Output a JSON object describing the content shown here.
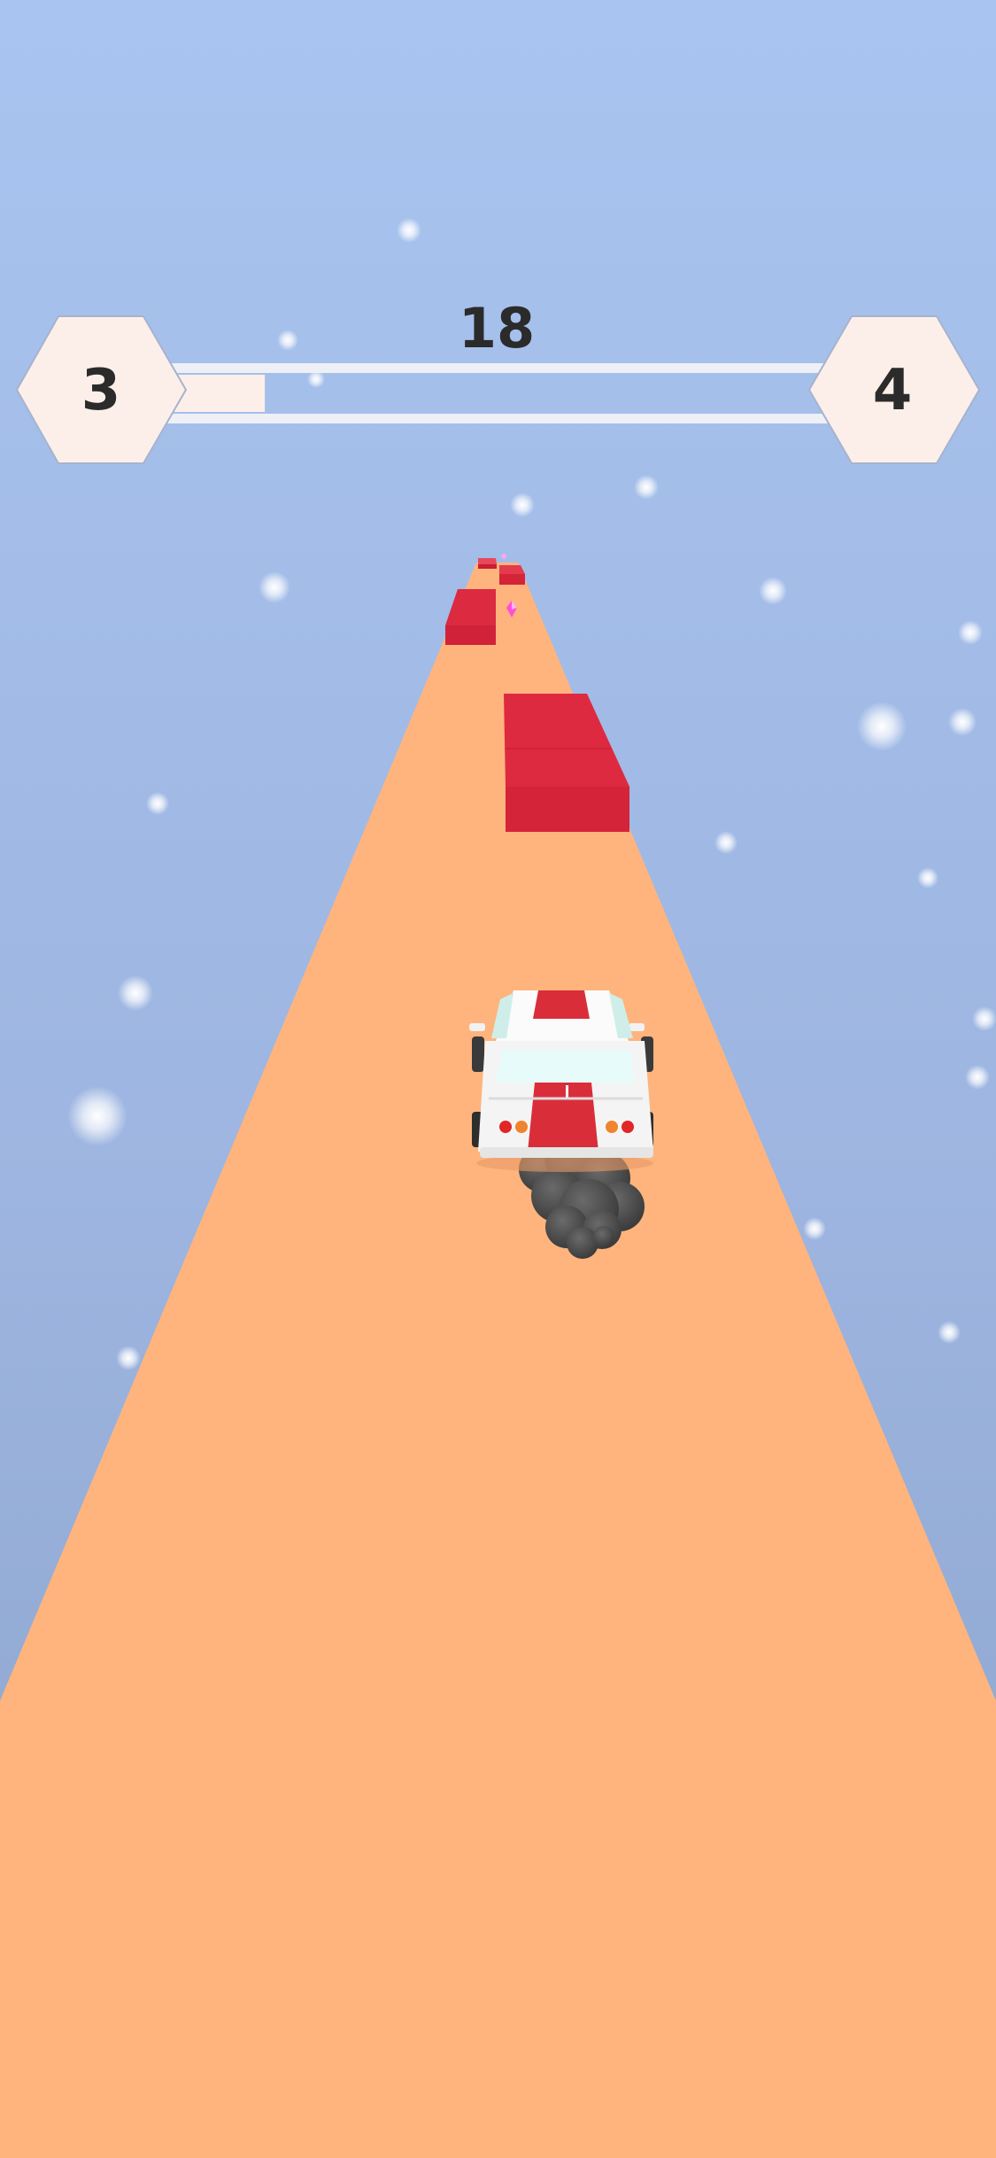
{
  "hud": {
    "score": "18",
    "current_level": "3",
    "next_level": "4",
    "level_progress": 0.15
  },
  "colors": {
    "sky_top": "#a9c4f0",
    "sky_bottom": "#8ea7cf",
    "road": "#ffb47e",
    "obstacle": "#dc2a40",
    "gem": "#ff4fd8",
    "hex_fill": "#fcefea",
    "car_body": "#fafafa",
    "car_stripe": "#d92e3a",
    "smoke": "#555555"
  },
  "scene": {
    "player": "car-with-racing-stripe",
    "obstacles": [
      "red-block",
      "red-block",
      "red-block",
      "red-block"
    ],
    "pickups": [
      "pink-gem"
    ],
    "effects": [
      "exhaust-smoke",
      "snowflakes"
    ]
  }
}
